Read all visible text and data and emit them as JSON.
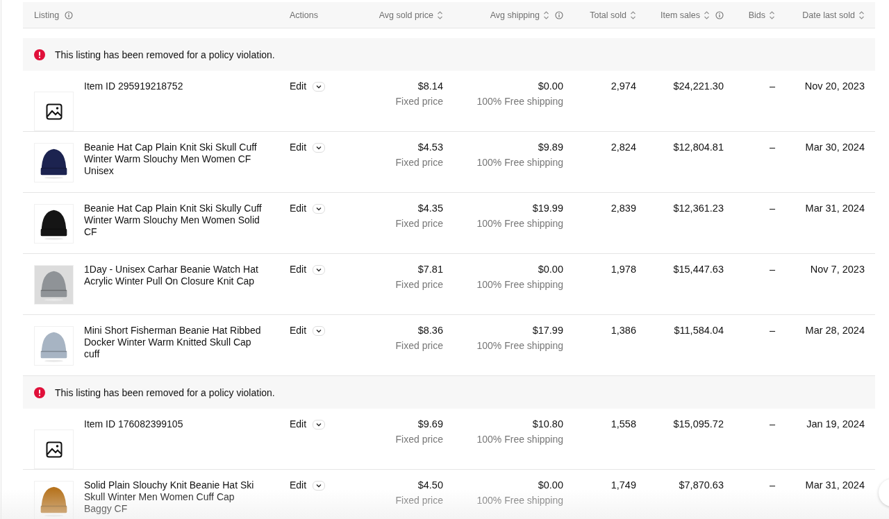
{
  "table": {
    "columns": [
      {
        "label": "Listing",
        "sortable": false,
        "info": true
      },
      {
        "label": "Actions",
        "sortable": false,
        "info": false
      },
      {
        "label": "Avg sold price",
        "sortable": true,
        "info": false
      },
      {
        "label": "Avg shipping",
        "sortable": true,
        "info": true
      },
      {
        "label": "Total sold",
        "sortable": true,
        "info": false
      },
      {
        "label": "Item sales",
        "sortable": true,
        "info": true
      },
      {
        "label": "Bids",
        "sortable": true,
        "info": false
      },
      {
        "label": "Date last sold",
        "sortable": true,
        "info": false
      }
    ],
    "rows": [
      {
        "kind": "alert",
        "message": "This listing has been removed for a policy violation."
      },
      {
        "kind": "listing",
        "has_photo": false,
        "title": "Item ID 295919218752",
        "action": "Edit",
        "avg_sold_price": "$8.14",
        "format": "Fixed price",
        "avg_shipping": "$0.00",
        "shipping_note": "100% Free shipping",
        "total_sold": "2,974",
        "item_sales": "$24,221.30",
        "bids": "–",
        "date_last_sold": "Nov 20, 2023"
      },
      {
        "kind": "listing",
        "has_photo": true,
        "title": "Beanie Hat Cap Plain Knit Ski Skull Cuff Winter Warm Slouchy Men Women CF Unisex",
        "action": "Edit",
        "avg_sold_price": "$4.53",
        "format": "Fixed price",
        "avg_shipping": "$9.89",
        "shipping_note": "100% Free shipping",
        "total_sold": "2,824",
        "item_sales": "$12,804.81",
        "bids": "–",
        "date_last_sold": "Mar 30, 2024"
      },
      {
        "kind": "listing",
        "has_photo": true,
        "title": "Beanie Hat Cap Plain Knit Ski Skully Cuff Winter Warm Slouchy Men Women Solid CF",
        "action": "Edit",
        "avg_sold_price": "$4.35",
        "format": "Fixed price",
        "avg_shipping": "$19.99",
        "shipping_note": "100% Free shipping",
        "total_sold": "2,839",
        "item_sales": "$12,361.23",
        "bids": "–",
        "date_last_sold": "Mar 31, 2024"
      },
      {
        "kind": "listing",
        "has_photo": true,
        "title": "1Day - Unisex Carhar Beanie Watch Hat Acrylic Winter Pull On Closure Knit Cap",
        "action": "Edit",
        "avg_sold_price": "$7.81",
        "format": "Fixed price",
        "avg_shipping": "$0.00",
        "shipping_note": "100% Free shipping",
        "total_sold": "1,978",
        "item_sales": "$15,447.63",
        "bids": "–",
        "date_last_sold": "Nov 7, 2023"
      },
      {
        "kind": "listing",
        "has_photo": true,
        "title": "Mini Short Fisherman Beanie Hat Ribbed Docker Winter Warm Knitted Skull Cap cuff",
        "action": "Edit",
        "avg_sold_price": "$8.36",
        "format": "Fixed price",
        "avg_shipping": "$17.99",
        "shipping_note": "100% Free shipping",
        "total_sold": "1,386",
        "item_sales": "$11,584.04",
        "bids": "–",
        "date_last_sold": "Mar 28, 2024"
      },
      {
        "kind": "alert",
        "message": "This listing has been removed for a policy violation."
      },
      {
        "kind": "listing",
        "has_photo": false,
        "title": "Item ID 176082399105",
        "action": "Edit",
        "avg_sold_price": "$9.69",
        "format": "Fixed price",
        "avg_shipping": "$10.80",
        "shipping_note": "100% Free shipping",
        "total_sold": "1,558",
        "item_sales": "$15,095.72",
        "bids": "–",
        "date_last_sold": "Jan 19, 2024"
      },
      {
        "kind": "listing",
        "has_photo": true,
        "title": "Solid Plain Slouchy Knit Beanie Hat Ski Skull Winter Men Women Cuff Cap Baggy CF",
        "action": "Edit",
        "avg_sold_price": "$4.50",
        "format": "Fixed price",
        "avg_shipping": "$0.00",
        "shipping_note": "100% Free shipping",
        "total_sold": "1,749",
        "item_sales": "$7,870.63",
        "bids": "–",
        "date_last_sold": "Mar 31, 2024"
      }
    ]
  }
}
